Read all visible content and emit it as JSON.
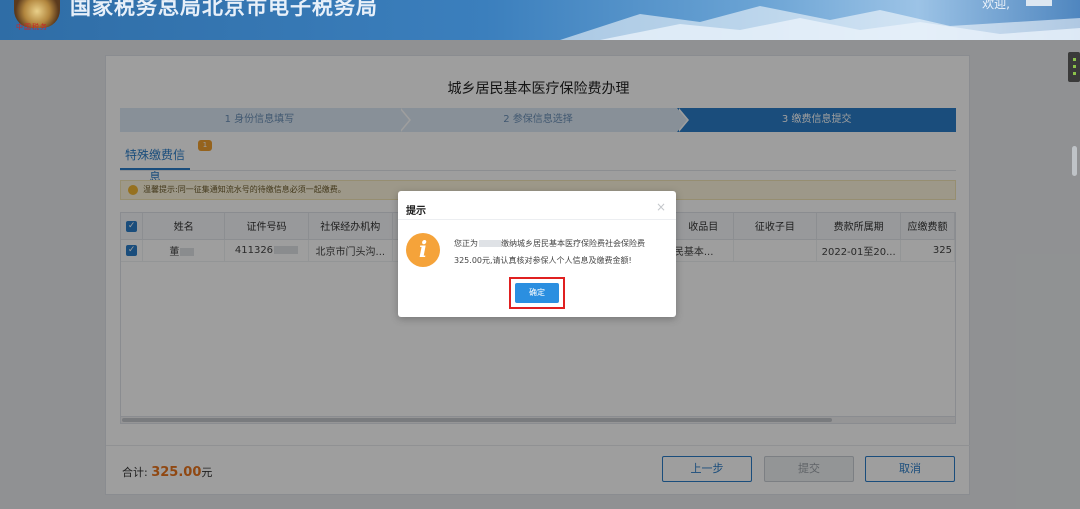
{
  "header": {
    "site_title": "国家税务总局北京市电子税务局",
    "emblem_text": "中国税务",
    "welcome": "欢迎,"
  },
  "page": {
    "title": "城乡居民基本医疗保险费办理",
    "steps": [
      {
        "label": "1 身份信息填写",
        "active": false
      },
      {
        "label": "2 参保信息选择",
        "active": false
      },
      {
        "label": "3 缴费信息提交",
        "active": true
      }
    ],
    "tab": {
      "label": "特殊缴费信息",
      "badge": "1"
    },
    "notice": "温馨提示:同一征集通知流水号的待缴信息必须一起缴费。"
  },
  "table": {
    "columns": [
      "姓名",
      "证件号码",
      "社保经办机构",
      "收品目",
      "征收子目",
      "费款所属期",
      "应缴费额"
    ],
    "rows": [
      {
        "checked": true,
        "name": "董",
        "id_number": "411326",
        "agency": "北京市门头沟...",
        "item": "民基本...",
        "sub_item": "",
        "period": "2022-01至20...",
        "amount": "325"
      }
    ]
  },
  "footer": {
    "total_label": "合计:",
    "total_amount": "325.00",
    "total_unit": "元",
    "prev_label": "上一步",
    "submit_label": "提交",
    "cancel_label": "取消"
  },
  "modal": {
    "title": "提示",
    "close": "×",
    "icon": "i",
    "message_part1": "您正为",
    "message_part2": "缴纳城乡居民基本医疗保险费社会保险费",
    "message_part3": "325.00元,请认真核对参保人个人信息及缴费金额!",
    "confirm_label": "确定"
  }
}
